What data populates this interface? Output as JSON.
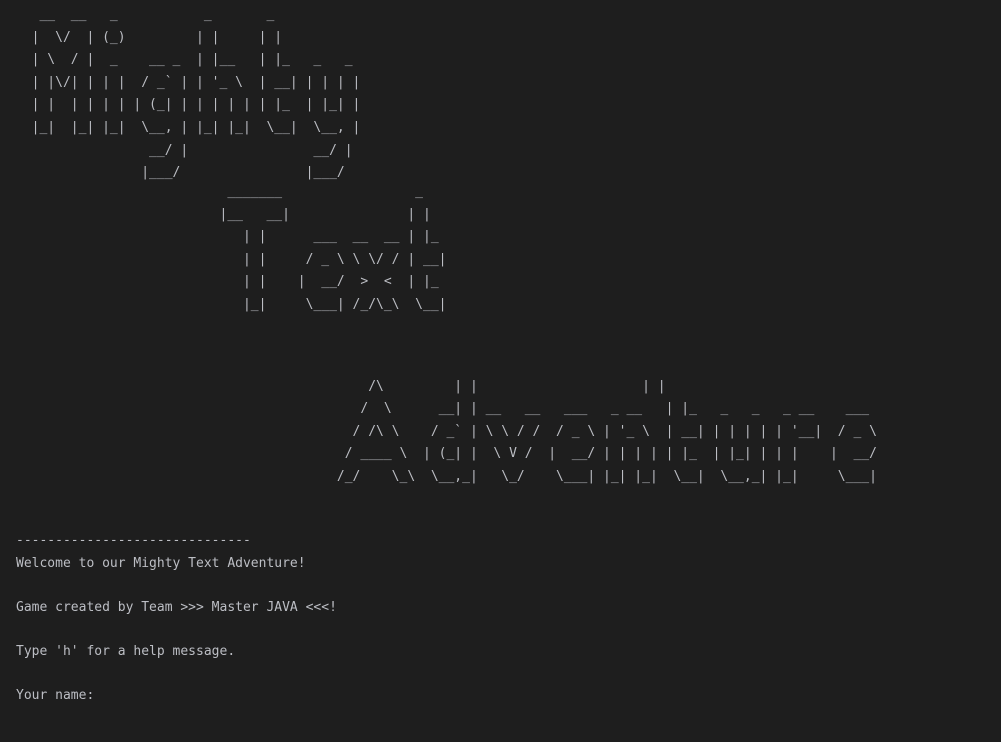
{
  "banner": {
    "mighty": "   __  __   _           _       _\n  |  \\/  | (_)         | |     | |\n  | \\  / |  _    __ _  | |__   | |_   _   _\n  | |\\/| | | |  / _` | | '_ \\  | __| | | | |\n  | |  | | | | | (_| | | | | | | |_  | |_| |\n  |_|  |_| |_|  \\__, | |_| |_|  \\__|  \\__, |\n                 __/ |                __/ |\n                |___/                |___/",
    "text": "                           _______                 _\n                          |__   __|               | |\n                             | |      ___  __  __ | |_\n                             | |     / _ \\ \\ \\/ / | __|\n                             | |    |  __/  >  <  | |_\n                             |_|     \\___| /_/\\_\\  \\__|",
    "adventure": "\n                                             /\\         | |                     | |\n                                            /  \\      __| | __   __   ___   _ __   | |_   _   _   _ __    ___\n                                           / /\\ \\    / _` | \\ \\ / /  / _ \\ | '_ \\  | __| | | | | | '__|  / _ \\\n                                          / ____ \\  | (_| |  \\ V /  |  __/ | | | | | |_  | |_| | | |    |  __/\n                                         /_/    \\_\\  \\__,_|   \\_/    \\___| |_| |_|  \\__|  \\__,_| |_|     \\___|"
  },
  "console": {
    "separator": "------------------------------",
    "welcome": "Welcome to our Mighty Text Adventure!",
    "credits": "Game created by Team >>> Master JAVA <<<!",
    "help_hint": "Type 'h' for a help message.",
    "prompt": "Your name: ",
    "input_value": ""
  }
}
